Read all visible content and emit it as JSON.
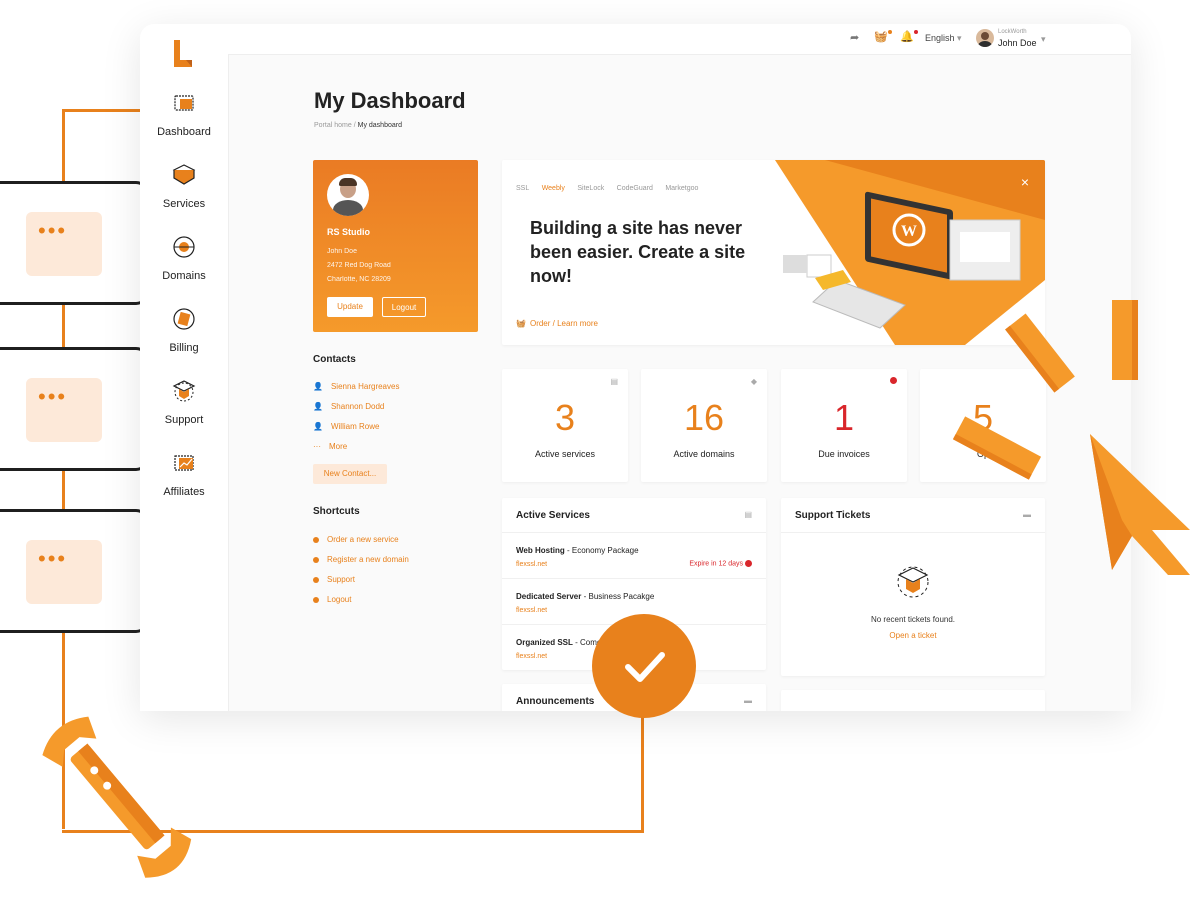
{
  "app": {
    "title": "My Dashboard",
    "breadcrumb": {
      "home": "Portal home",
      "separator": "/",
      "current": "My dashboard"
    }
  },
  "topbar": {
    "language": "English",
    "user_company": "LockWorth",
    "user_name": "John Doe"
  },
  "sidebar": {
    "items": [
      {
        "label": "Dashboard",
        "icon": "dashboard-icon"
      },
      {
        "label": "Services",
        "icon": "services-icon"
      },
      {
        "label": "Domains",
        "icon": "globe-icon"
      },
      {
        "label": "Billing",
        "icon": "billing-icon"
      },
      {
        "label": "Support",
        "icon": "support-icon"
      },
      {
        "label": "Affiliates",
        "icon": "affiliates-icon"
      }
    ]
  },
  "profile": {
    "company": "RS Studio",
    "name": "John Doe",
    "address1": "2472 Red Dog Road",
    "address2": "Charlotte, NC 28209",
    "update_label": "Update",
    "logout_label": "Logout"
  },
  "contacts": {
    "title": "Contacts",
    "items": [
      "Sienna Hargreaves",
      "Shannon Dodd",
      "William Rowe"
    ],
    "more_label": "More",
    "new_contact_label": "New Contact..."
  },
  "shortcuts": {
    "title": "Shortcuts",
    "items": [
      "Order a new service",
      "Register a new domain",
      "Support",
      "Logout"
    ]
  },
  "promo": {
    "tabs": [
      "SSL",
      "Weebly",
      "SiteLock",
      "CodeGuard",
      "Marketgoo"
    ],
    "active_tab": "Weebly",
    "headline": "Building a site has never been easier. Create a site now!",
    "cta": "Order / Learn more",
    "close": "×"
  },
  "stats": [
    {
      "value": "3",
      "label": "Active services"
    },
    {
      "value": "16",
      "label": "Active domains"
    },
    {
      "value": "1",
      "label": "Due invoices"
    },
    {
      "value": "5",
      "label": "Op"
    }
  ],
  "active_services": {
    "title": "Active Services",
    "rows": [
      {
        "name": "Web Hosting",
        "plan": " - Economy Package",
        "url": "flexssl.net",
        "expire": "Expire in 12 days"
      },
      {
        "name": "Dedicated Server",
        "plan": " - Business Pacakge",
        "url": "flexssl.net",
        "expire": ""
      },
      {
        "name": "Organized SSL",
        "plan": " - Como",
        "url": "flexssl.net",
        "expire": ""
      }
    ]
  },
  "support_tickets": {
    "title": "Support Tickets",
    "empty": "No recent tickets found.",
    "open_label": "Open a ticket"
  },
  "announcements": {
    "title": "Announcements"
  },
  "colors": {
    "accent": "#e8811c",
    "dark": "#1f1f1f",
    "alert": "#d9262b"
  }
}
